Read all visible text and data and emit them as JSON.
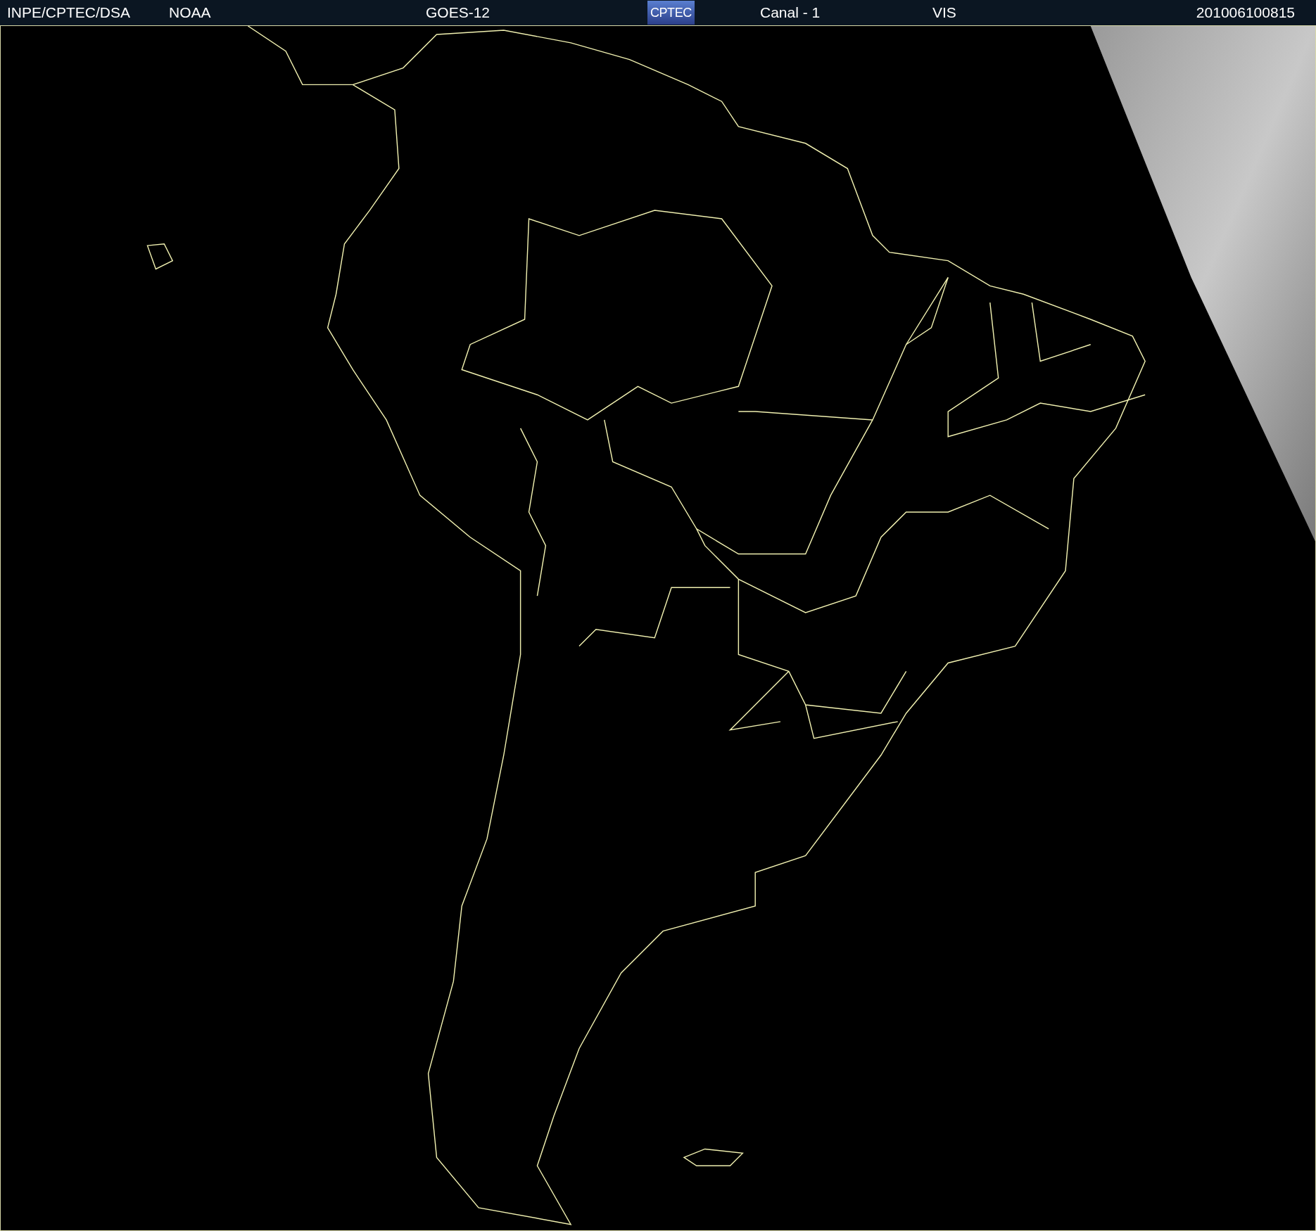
{
  "header": {
    "items": [
      {
        "kind": "text",
        "text": "INPE/CPTEC/DSA"
      },
      {
        "kind": "text",
        "text": "NOAA"
      },
      {
        "kind": "text",
        "text": "GOES-12"
      },
      {
        "kind": "logo",
        "text": "CPTEC"
      },
      {
        "kind": "text",
        "text": "Canal - 1"
      },
      {
        "kind": "text",
        "text": "VIS"
      },
      {
        "kind": "text",
        "text": "201006100815"
      }
    ]
  }
}
